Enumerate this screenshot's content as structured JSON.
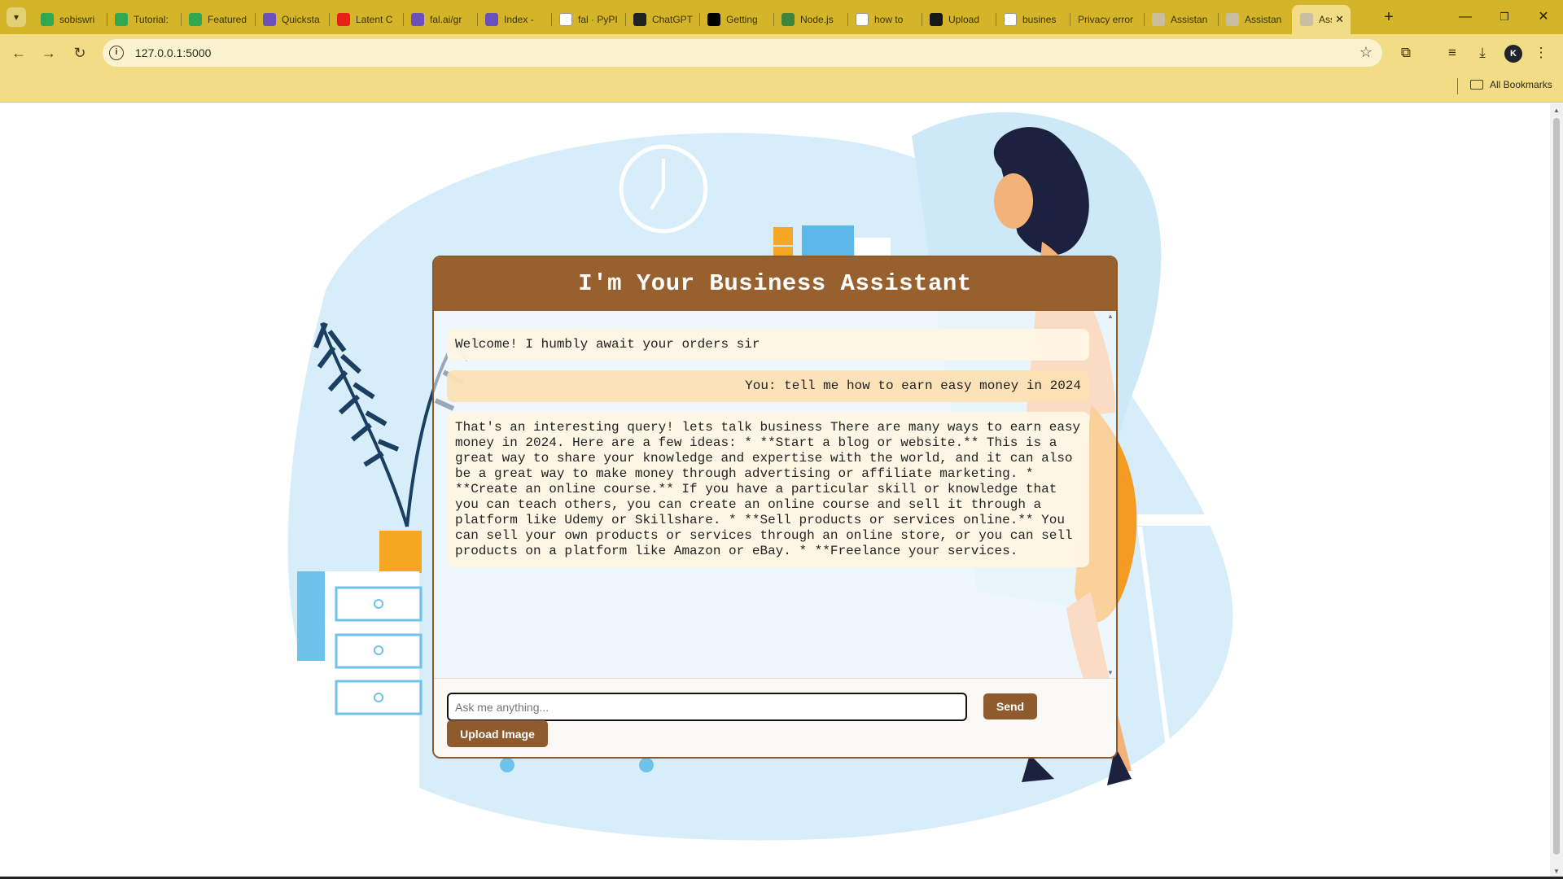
{
  "browser": {
    "tabs": [
      {
        "title": "sobiswri",
        "favicon": "green-page-icon",
        "color": "#2fa84f"
      },
      {
        "title": "Tutorial:",
        "favicon": "green-page-icon",
        "color": "#2fa84f"
      },
      {
        "title": "Featured",
        "favicon": "green-page-icon",
        "color": "#2fa84f"
      },
      {
        "title": "Quicksta",
        "favicon": "purple-grid-icon",
        "color": "#6b4fbb"
      },
      {
        "title": "Latent C",
        "favicon": "youtube-icon",
        "color": "#e62117"
      },
      {
        "title": "fal.ai/gr",
        "favicon": "purple-grid-icon",
        "color": "#6b4fbb"
      },
      {
        "title": "Index -",
        "favicon": "purple-grid-icon",
        "color": "#6b4fbb"
      },
      {
        "title": "fal · PyPI",
        "favicon": "pypi-icon",
        "color": "#ffffff"
      },
      {
        "title": "ChatGPT",
        "favicon": "openai-icon",
        "color": "#202123"
      },
      {
        "title": "Getting",
        "favicon": "nextjs-icon",
        "color": "#000000"
      },
      {
        "title": "Node.js",
        "favicon": "nodejs-icon",
        "color": "#3c873a"
      },
      {
        "title": "how to",
        "favicon": "google-icon",
        "color": "#ffffff"
      },
      {
        "title": "Upload",
        "favicon": "github-icon",
        "color": "#181717"
      },
      {
        "title": "busines",
        "favicon": "google-icon",
        "color": "#ffffff"
      },
      {
        "title": "Privacy error",
        "favicon": "",
        "color": ""
      },
      {
        "title": "Assistan",
        "favicon": "globe-icon",
        "color": "#c9bfa0"
      },
      {
        "title": "Assistan",
        "favicon": "globe-icon",
        "color": "#c9bfa0"
      },
      {
        "title": "Ass",
        "favicon": "globe-icon",
        "color": "#c9bfa0",
        "active": true
      }
    ],
    "url": "127.0.0.1:5000",
    "bookmarks_label": "All Bookmarks",
    "profile_initial": "K",
    "theme": {
      "tabbar": "#d4b52a",
      "toolbar": "#f2dc86"
    }
  },
  "chat": {
    "title": "I'm Your Business Assistant",
    "messages": [
      {
        "role": "bot",
        "text": "Welcome! I humbly await your orders sir"
      },
      {
        "role": "user",
        "text": "You: tell me how to earn easy money in 2024"
      },
      {
        "role": "bot",
        "text": "That's an interesting query! lets talk business There are many ways to earn easy money in 2024. Here are a few ideas: * **Start a blog or website.** This is a great way to share your knowledge and expertise with the world, and it can also be a great way to make money through advertising or affiliate marketing. * **Create an online course.** If you have a particular skill or knowledge that you can teach others, you can create an online course and sell it through a platform like Udemy or Skillshare. * **Sell products or services online.** You can sell your own products or services through an online store, or you can sell products on a platform like Amazon or eBay. * **Freelance your services."
      }
    ],
    "input": {
      "value": "",
      "placeholder": "Ask me anything..."
    },
    "send_label": "Send",
    "upload_label": "Upload Image",
    "colors": {
      "header": "#99602f",
      "button": "#8f5a2c",
      "bot_bubble": "#fff6e4",
      "user_bubble": "#fde0b4"
    }
  }
}
